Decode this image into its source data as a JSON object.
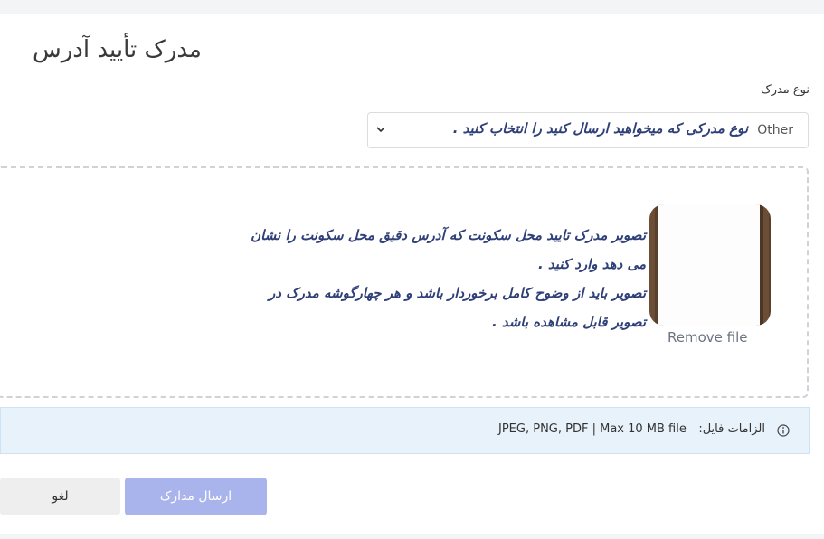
{
  "page": {
    "title": "مدرک تأیید آدرس"
  },
  "document_type": {
    "label": "نوع مدرک",
    "selected_value": "Other",
    "hint": "نوع مدرکی که میخواهید ارسال کنید را انتخاب کنید ."
  },
  "upload": {
    "instructions": [
      "تصویر مدرک تایید محل سکونت که آدرس دقیق محل سکونت را نشان",
      "می دهد وارد کنید .",
      "تصویر باید از وضوح کامل برخوردار باشد و  هر چهارگوشه مدرک در",
      "تصویر قابل مشاهده باشد ."
    ],
    "remove_label": "Remove file"
  },
  "requirements": {
    "label": "الزامات فایل:",
    "value": "JPEG, PNG, PDF | Max 10 MB file"
  },
  "actions": {
    "cancel_label": "لغو",
    "submit_label": "ارسال مدارک"
  },
  "icons": {
    "select_chevron": "chevron-down-icon",
    "info": "info-icon"
  },
  "colors": {
    "accent": "#a9b4ec",
    "annotation_text": "#2f3f78",
    "info_background": "#e8f2fb"
  }
}
